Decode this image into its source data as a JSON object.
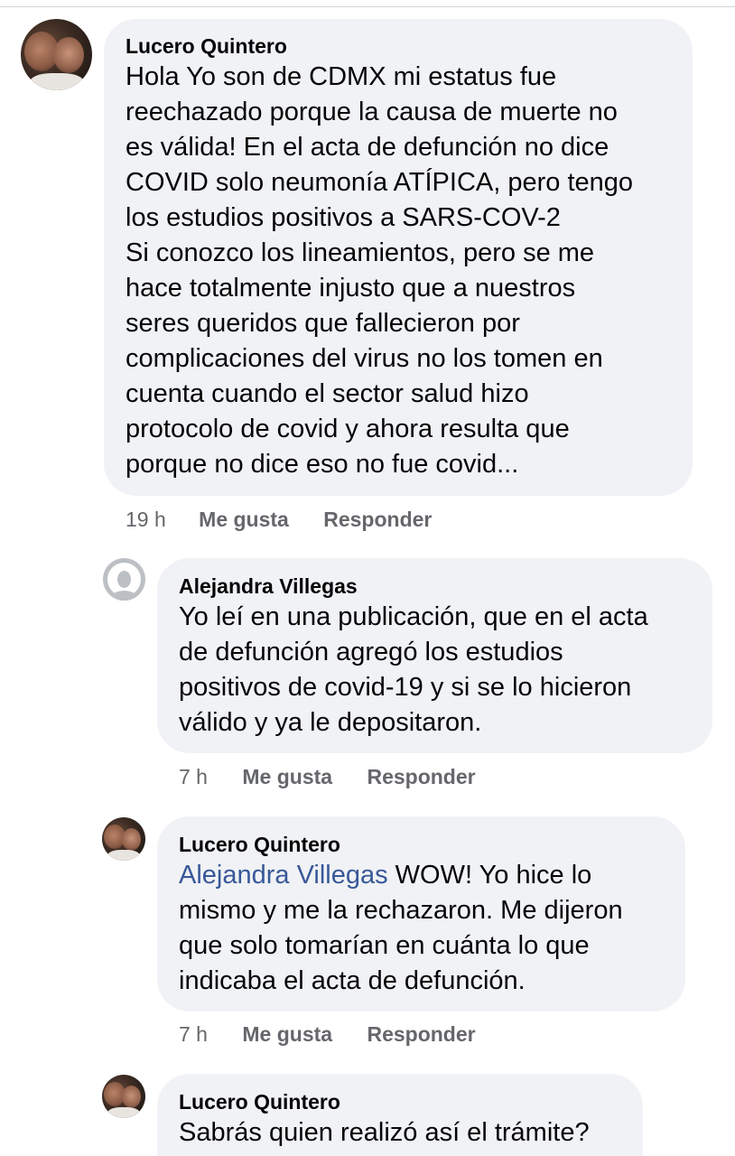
{
  "comments": [
    {
      "author": "Lucero Quintero",
      "text": "Hola Yo son de CDMX mi estatus fue\nreechazado porque la causa de muerte no\nes válida! En el acta de defunción no dice\nCOVID solo neumonía ATÍPICA, pero tengo\nlos estudios positivos a SARS-COV-2\nSi conozco los lineamientos, pero se me\nhace totalmente injusto que a nuestros\nseres queridos que fallecieron por\ncomplicaciones del virus no los tomen en\ncuenta cuando el sector salud hizo\nprotocolo de covid y ahora resulta que\nporque no dice eso no fue covid...",
      "time": "19 h",
      "like": "Me gusta",
      "reply": "Responder"
    },
    {
      "author": "Alejandra Villegas",
      "text": "Yo leí en una publicación, que en el acta\nde defunción agregó los estudios\npositivos de covid-19 y si se lo hicieron\nválido y ya le depositaron.",
      "time": "7 h",
      "like": "Me gusta",
      "reply": "Responder"
    },
    {
      "author": "Lucero Quintero",
      "mention": "Alejandra Villegas",
      "text": " WOW! Yo hice lo\nmismo y me la rechazaron. Me dijeron\nque solo tomarían en cuánta lo que\nindicaba el acta de defunción.",
      "time": "7 h",
      "like": "Me gusta",
      "reply": "Responder"
    },
    {
      "author": "Lucero Quintero",
      "text": "Sabrás quien realizó así el trámite?"
    }
  ],
  "colors": {
    "bubble": "#f0f2f5",
    "text": "#050505",
    "meta": "#65676b",
    "mention": "#385898"
  }
}
